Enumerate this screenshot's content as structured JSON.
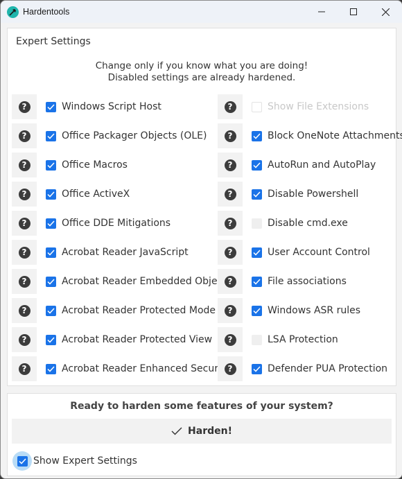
{
  "window": {
    "title": "Hardentools",
    "controls": [
      "minimize",
      "maximize",
      "close"
    ]
  },
  "expert_panel": {
    "title": "Expert Settings",
    "notice_line1": "Change only if you know what you are doing!",
    "notice_line2": "Disabled settings are already hardened.",
    "left_column": [
      {
        "label": "Windows Script Host",
        "checked": true,
        "enabled": true
      },
      {
        "label": "Office Packager Objects (OLE)",
        "checked": true,
        "enabled": true
      },
      {
        "label": "Office Macros",
        "checked": true,
        "enabled": true
      },
      {
        "label": "Office ActiveX",
        "checked": true,
        "enabled": true
      },
      {
        "label": "Office DDE Mitigations",
        "checked": true,
        "enabled": true
      },
      {
        "label": "Acrobat Reader JavaScript",
        "checked": true,
        "enabled": true
      },
      {
        "label": "Acrobat Reader Embedded Objects",
        "checked": true,
        "enabled": true
      },
      {
        "label": "Acrobat Reader Protected Mode",
        "checked": true,
        "enabled": true
      },
      {
        "label": "Acrobat Reader Protected View",
        "checked": true,
        "enabled": true
      },
      {
        "label": "Acrobat Reader Enhanced Security",
        "checked": true,
        "enabled": true
      }
    ],
    "right_column": [
      {
        "label": "Show File Extensions",
        "checked": false,
        "enabled": false
      },
      {
        "label": "Block OneNote Attachments",
        "checked": true,
        "enabled": true
      },
      {
        "label": "AutoRun and AutoPlay",
        "checked": true,
        "enabled": true
      },
      {
        "label": "Disable Powershell",
        "checked": true,
        "enabled": true
      },
      {
        "label": "Disable cmd.exe",
        "checked": false,
        "enabled": true
      },
      {
        "label": "User Account Control",
        "checked": true,
        "enabled": true
      },
      {
        "label": "File associations",
        "checked": true,
        "enabled": true
      },
      {
        "label": "Windows ASR rules",
        "checked": true,
        "enabled": true
      },
      {
        "label": "LSA Protection",
        "checked": false,
        "enabled": true
      },
      {
        "label": "Defender PUA Protection",
        "checked": true,
        "enabled": true
      }
    ],
    "help_glyph": "?"
  },
  "bottom": {
    "prompt": "Ready to harden some features of your system?",
    "harden_button": "Harden!",
    "show_expert_label": "Show Expert Settings",
    "show_expert_checked": true
  },
  "colors": {
    "accent": "#1a73e8",
    "app_icon": "#1fb5ac"
  }
}
